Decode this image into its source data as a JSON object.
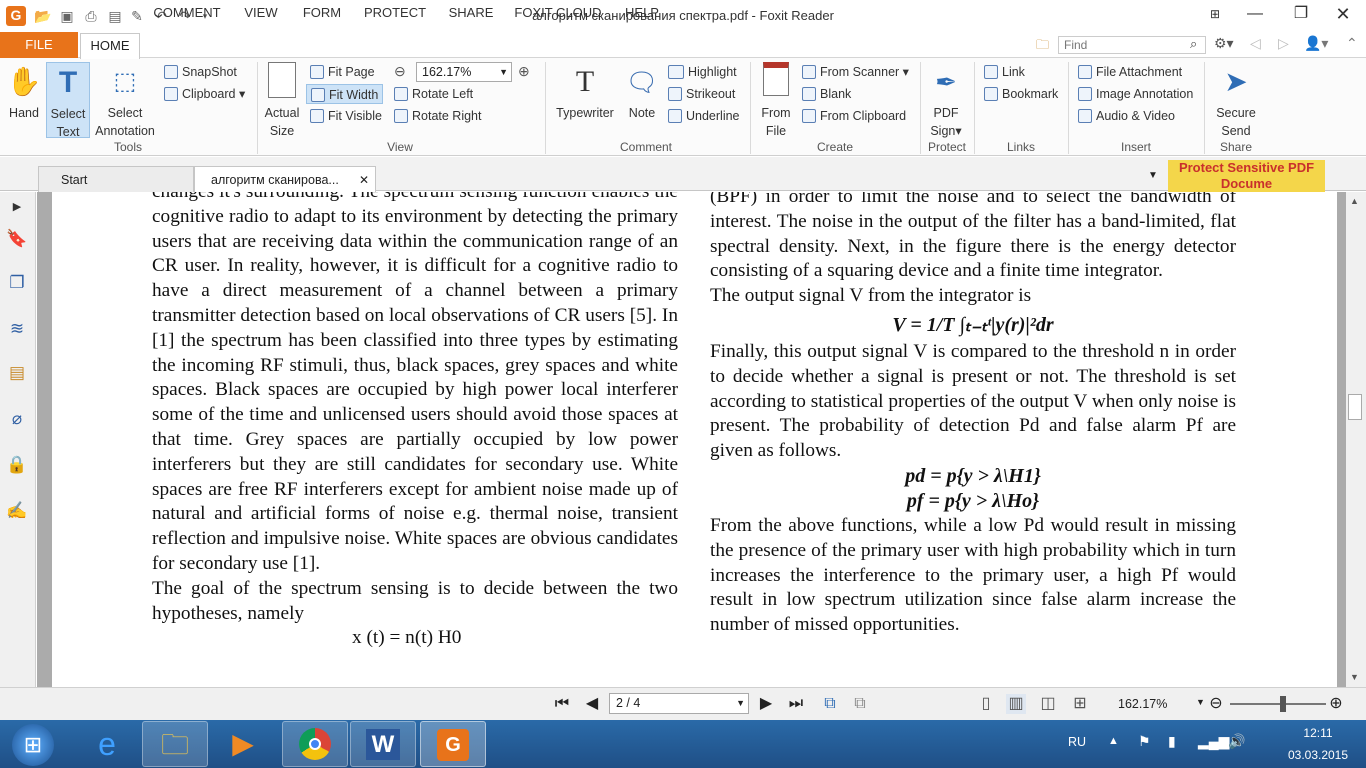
{
  "window": {
    "title": "алгоритм сканирования спектра.pdf - Foxit Reader"
  },
  "menu": {
    "file": "FILE",
    "tabs": [
      "HOME",
      "COMMENT",
      "VIEW",
      "FORM",
      "PROTECT",
      "SHARE",
      "FOXIT CLOUD",
      "HELP"
    ]
  },
  "find": {
    "placeholder": "Find"
  },
  "ribbon": {
    "hand": "Hand",
    "select_text": [
      "Select",
      "Text"
    ],
    "select_annotation": [
      "Select",
      "Annotation"
    ],
    "snapshot": "SnapShot",
    "clipboard": "Clipboard",
    "actual_size": [
      "Actual",
      "Size"
    ],
    "fit_page": "Fit Page",
    "fit_width": "Fit Width",
    "fit_visible": "Fit Visible",
    "zoom_value": "162.17%",
    "rotate_left": "Rotate Left",
    "rotate_right": "Rotate Right",
    "typewriter": "Typewriter",
    "note": "Note",
    "highlight": "Highlight",
    "strikeout": "Strikeout",
    "underline": "Underline",
    "from_file": [
      "From",
      "File"
    ],
    "from_scanner": "From Scanner",
    "blank": "Blank",
    "from_clipboard": "From Clipboard",
    "pdf_sign": [
      "PDF",
      "Sign"
    ],
    "link": "Link",
    "bookmark": "Bookmark",
    "file_attachment": "File Attachment",
    "image_annotation": "Image Annotation",
    "audio_video": "Audio & Video",
    "secure_send": [
      "Secure",
      "Send"
    ],
    "groups": {
      "tools": "Tools",
      "view": "View",
      "comment": "Comment",
      "create": "Create",
      "protect": "Protect",
      "links": "Links",
      "insert": "Insert",
      "share": "Share"
    }
  },
  "doc_tabs": [
    "Start",
    "алгоритм сканирова..."
  ],
  "banner": "Protect Sensitive PDF Docume",
  "document": {
    "left_column": [
      "changes it's surrounding. The spectrum sensing function enables the cognitive radio to adapt to its environment by detecting the primary users that are receiving data within the communication range of an CR user. In reality, however, it is difficult for a cognitive radio to have a direct measurement of a channel between a primary transmitter detection based on local observations of CR users [5]. In [1] the spectrum has been classified into three types by estimating the incoming RF stimuli, thus, black spaces, grey spaces and white spaces. Black spaces are occupied by high power local interferer some of the time and unlicensed users should avoid those spaces at that time. Grey spaces are partially occupied by low power interferers but they are still candidates for secondary use. White spaces are free RF interferers except for ambient noise made up of natural and artificial forms of noise e.g. thermal noise, transient reflection and impulsive noise. White spaces are obvious candidates for secondary use [1].",
      "The goal of the spectrum sensing is to decide between the two hypotheses, namely",
      "x (t) = n(t)  H0"
    ],
    "right_top": "(BPF) in order to limit the noise and to select the bandwidth of interest. The noise in the output of the filter has a band-limited, flat spectral density. Next, in the figure there is the energy detector consisting of a squaring device and a finite time integrator.",
    "right_line2": "The output signal V from the integrator is",
    "eq_v": "V = 1/T ∫ₜ₋ₜᵗ|y(r)|²dr",
    "right_mid": "Finally, this output signal V is compared to the threshold n in order to decide whether a signal is present or not. The threshold is set according to statistical properties of the output V when only noise is present. The probability of detection Pd and false alarm Pf are given as follows.",
    "eq_pd": "pd = p{y > λ\\H1}",
    "eq_pf": "pf = p{y > λ\\Ho}",
    "right_bottom": "From the above functions, while a low Pd would result in missing the presence of the primary user with high probability which in turn increases the interference to the primary user, a high Pf would result in low spectrum utilization since false alarm increase the number of missed opportunities."
  },
  "status": {
    "page": "2 / 4",
    "zoom": "162.17%"
  },
  "taskbar": {
    "lang": "RU",
    "time": "12:11",
    "date": "03.03.2015"
  }
}
